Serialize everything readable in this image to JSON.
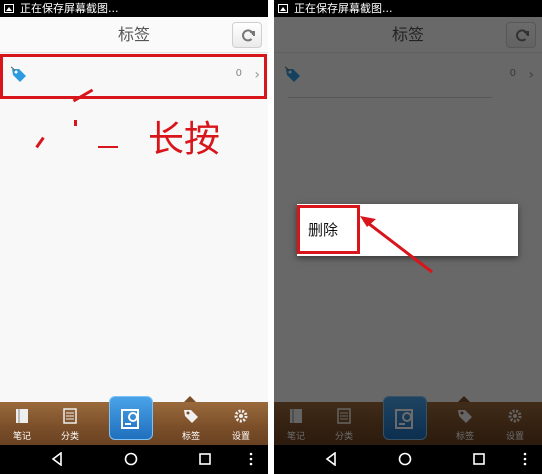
{
  "left_screen": {
    "status_text": "正在保存屏幕截图...",
    "title": "标签",
    "tag_row": {
      "count": "0",
      "chevron": "›"
    },
    "annotation": "长按",
    "tabs": [
      {
        "label": "笔记",
        "icon": "note-icon"
      },
      {
        "label": "分类",
        "icon": "category-icon"
      },
      {
        "label": "",
        "icon": "new-note-icon"
      },
      {
        "label": "标签",
        "icon": "tag-icon"
      },
      {
        "label": "设置",
        "icon": "gear-icon"
      }
    ]
  },
  "right_screen": {
    "status_text": "正在保存屏幕截图...",
    "title": "标签",
    "tag_row": {
      "count": "0",
      "chevron": "›"
    },
    "dialog": {
      "delete_label": "删除"
    },
    "tabs": [
      {
        "label": "笔记",
        "icon": "note-icon"
      },
      {
        "label": "分类",
        "icon": "category-icon"
      },
      {
        "label": "",
        "icon": "new-note-icon"
      },
      {
        "label": "标签",
        "icon": "tag-icon"
      },
      {
        "label": "设置",
        "icon": "gear-icon"
      }
    ]
  },
  "colors": {
    "annotation_red": "#d8151b",
    "tabbar_wood": "#7a4e29",
    "center_tab_blue": "#1f6fbd",
    "tag_icon_blue": "#2e9be0"
  }
}
